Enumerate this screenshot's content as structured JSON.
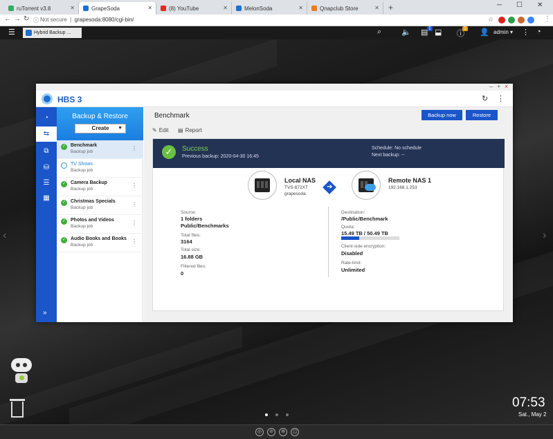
{
  "browser": {
    "tabs": [
      "ruTorrent v3.8",
      "GrapeSoda",
      "(8) YouTube",
      "MelonSoda",
      "Qnapclub Store"
    ],
    "active_tab_index": 1,
    "url_prefix": "Not secure",
    "url": "grapesoda:8080/cgi-bin/",
    "new_tab": "+",
    "colors": {
      "tabbar": "#dee1e6",
      "active_tab": "#ffffff"
    }
  },
  "qts": {
    "app_tab_label": "Hybrid Backup ...",
    "user": "admin",
    "badges": {
      "notifications": "1",
      "events": "1"
    }
  },
  "window": {
    "app_name": "HBS 3",
    "controls": [
      "–",
      "+",
      "×"
    ]
  },
  "sidebar": {
    "title": "Backup & Restore",
    "create_label": "Create",
    "jobs": [
      {
        "name": "Benchmark",
        "sub": "Backup job",
        "status": "success",
        "selected": true
      },
      {
        "name": "TV Shows",
        "sub": "Backup job",
        "status": "new",
        "selected": false
      },
      {
        "name": "Camera Backup",
        "sub": "Backup job",
        "status": "success",
        "selected": false
      },
      {
        "name": "Christmas Specials",
        "sub": "Backup job",
        "status": "success",
        "selected": false
      },
      {
        "name": "Photos and Videos",
        "sub": "Backup job",
        "status": "success",
        "selected": false
      },
      {
        "name": "Audio Books and Books",
        "sub": "Backup job",
        "status": "success",
        "selected": false
      }
    ],
    "expand_icon": "»"
  },
  "main": {
    "title": "Benchmark",
    "backup_now": "Backup now",
    "restore": "Restore",
    "edit": "Edit",
    "report": "Report",
    "status": "Success",
    "previous_backup": "Previous backup: 2020-04-30 16:45",
    "schedule": "Schedule: No schedule",
    "next_backup": "Next backup: --",
    "local": {
      "name": "Local NAS",
      "model": "TVS-872XT",
      "host": "grapesoda"
    },
    "remote": {
      "name": "Remote NAS 1",
      "ip": "192.168.1.253"
    },
    "source": {
      "source_label": "Source:",
      "source_value1": "1 folders",
      "source_value2": "Public/Benchmarks",
      "total_files_label": "Total files:",
      "total_files": "3164",
      "total_size_label": "Total size:",
      "total_size": "16.88 GB",
      "filtered_label": "Filtered files:",
      "filtered": "0"
    },
    "destination": {
      "dest_label": "Destination:",
      "dest_value": "/Public/Benchmark",
      "quota_label": "Quota:",
      "quota_value": "15.49 TB / 50.49 TB",
      "quota_fraction": 0.307,
      "encryption_label": "Client-side encryption:",
      "encryption_value": "Disabled",
      "rate_label": "Rate-limit:",
      "rate_value": "Unlimited"
    }
  },
  "desktop": {
    "time": "07:53",
    "date": "Sat., May 2",
    "pages": 3,
    "current_page": 1
  },
  "colors": {
    "accent": "#1a55c9",
    "banner": "#233354",
    "success": "#6bc043",
    "sidebar_header": "#1c7ee0"
  }
}
